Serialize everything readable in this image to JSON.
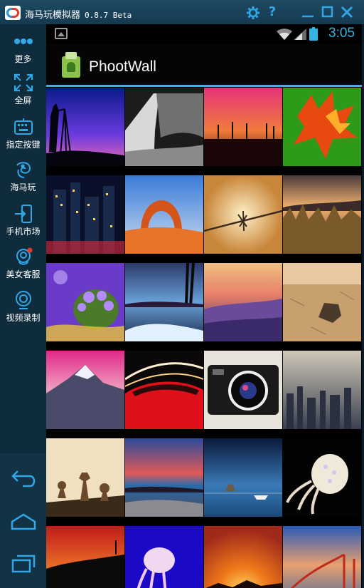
{
  "window": {
    "title": "海马玩模拟器",
    "version": "0.8.7 Beta",
    "controls": [
      "gear-icon",
      "help-icon",
      "minimize-icon",
      "maximize-icon",
      "close-icon"
    ]
  },
  "sidebar": {
    "items": [
      {
        "label": "更多",
        "icon": "more-dots-icon"
      },
      {
        "label": "全屏",
        "icon": "fullscreen-icon"
      },
      {
        "label": "指定按键",
        "icon": "keyboard-icon"
      },
      {
        "label": "海马玩",
        "icon": "seahorse-icon"
      },
      {
        "label": "手机市场",
        "icon": "market-icon"
      },
      {
        "label": "美女客服",
        "icon": "support-icon"
      },
      {
        "label": "视频录制",
        "icon": "record-icon"
      }
    ],
    "nav": [
      "back-icon",
      "home-icon",
      "recent-apps-icon"
    ]
  },
  "status_bar": {
    "time": "3:05"
  },
  "action_bar": {
    "title": "PhootWall"
  },
  "photos": [
    {
      "name": "photo-silhouette-tripod"
    },
    {
      "name": "photo-bw-rock-arch"
    },
    {
      "name": "photo-wind-turbines"
    },
    {
      "name": "photo-autumn-leaves"
    },
    {
      "name": "photo-city-night"
    },
    {
      "name": "photo-delicate-arch"
    },
    {
      "name": "photo-barbed-wire"
    },
    {
      "name": "photo-grass-sunset"
    },
    {
      "name": "photo-purple-flowers"
    },
    {
      "name": "photo-lake-trees"
    },
    {
      "name": "photo-purple-mountains"
    },
    {
      "name": "photo-desert-rock"
    },
    {
      "name": "photo-snowy-mountain"
    },
    {
      "name": "photo-red-car-lights"
    },
    {
      "name": "photo-leica-camera"
    },
    {
      "name": "photo-city-haze"
    },
    {
      "name": "photo-chess-pieces"
    },
    {
      "name": "photo-beach-sunset"
    },
    {
      "name": "photo-lake-boat"
    },
    {
      "name": "photo-jellyfish"
    },
    {
      "name": "photo-sunset-silhouette"
    },
    {
      "name": "photo-blue-jellyfish"
    },
    {
      "name": "photo-orange-sunrise"
    },
    {
      "name": "photo-golden-gate"
    }
  ]
}
